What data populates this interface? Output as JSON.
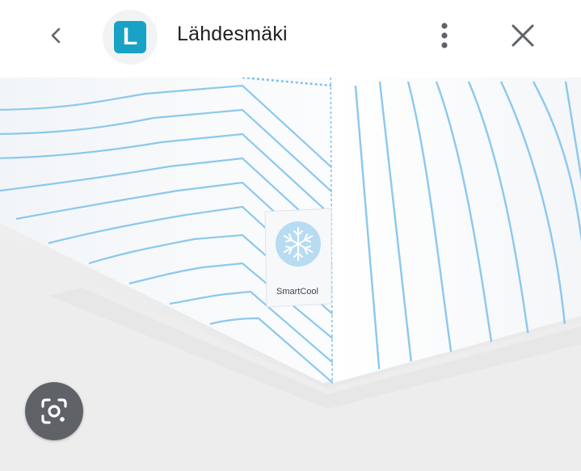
{
  "header": {
    "back_icon": "chevron-left-icon",
    "avatar_letter": "L",
    "avatar_color": "#18a3c6",
    "site_title": "Lähdesmäki",
    "more_icon": "more-vert-icon",
    "close_icon": "close-icon"
  },
  "photo": {
    "tag_text": "SmartCool",
    "tag_icon": "snowflake-icon",
    "stripe_color": "#8cc8ee"
  },
  "lens_button": {
    "icon": "google-lens-icon"
  }
}
